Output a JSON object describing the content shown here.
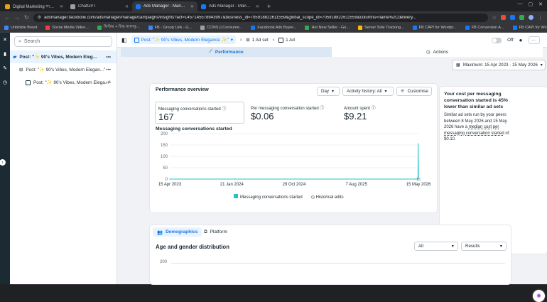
{
  "browser": {
    "tabs": [
      {
        "title": "Digital Marketing সার্ভিসেস স্প্রে",
        "color": "#e4a11b",
        "active": false
      },
      {
        "title": "ChatGPT",
        "color": "#9aa0a6",
        "active": false
      },
      {
        "title": "Ads Manager - Manage ads - C",
        "color": "#1877f2",
        "active": true
      },
      {
        "title": "Ads Manager - Manage ads - A",
        "color": "#1877f2",
        "active": false
      }
    ],
    "new_tab": "+",
    "url": "adsmanager.facebook.com/adsmanager/manage/campaigns/insights?act=1457145578943997&business_id=705918822611559&global_scope_id=705918822611559&columns=name%2Cdelivery...",
    "bookmarks": [
      {
        "label": "Unblokte Boost",
        "color": "#4285f4"
      },
      {
        "label": "Social Media Video...",
        "color": "#ea4335"
      },
      {
        "label": "ফিল্টার + রিস্ক ক্যালকু...",
        "color": "#34a853"
      },
      {
        "label": "FB - Group Link - G...",
        "color": "#4285f4"
      },
      {
        "label": "CCMS || Consume...",
        "color": "#9aa0a6"
      },
      {
        "label": "Facebook Ads Buyer...",
        "color": "#1877f2"
      },
      {
        "label": "Hot New Seller - Go...",
        "color": "#34a853"
      },
      {
        "label": "Server Side Tracking...",
        "color": "#fbbc05"
      },
      {
        "label": "FB CAPI for Wordpr...",
        "color": "#1877f2"
      },
      {
        "label": "FB Conversion A...",
        "color": "#1877f2"
      },
      {
        "label": "FB CAPI for Wordpr...",
        "color": "#1877f2"
      }
    ]
  },
  "left_tree": {
    "search_placeholder": "Search",
    "items": [
      {
        "label": "Post: \"✨ 90's Vibes, Modern Elegance...\"",
        "level": 0,
        "selected": true
      },
      {
        "label": "Post: \"✨ 90's Vibes, Modern Elegan...\"",
        "level": 1,
        "selected": false
      },
      {
        "label": "Post: \"✨ 90's Vibes, Modern Elega...\"",
        "level": 2,
        "selected": false
      }
    ]
  },
  "topbar": {
    "campaign": "Post: \"✨ 90's Vibes, Modern Elegance ✨\"",
    "adset": "1 Ad set",
    "ad": "1 Ad",
    "toggle_label": "Off",
    "more": "···"
  },
  "tabs": {
    "performance": "Performance",
    "actions": "Actions"
  },
  "date_range": "Maximum: 15 Apr 2023 - 15 May 2026",
  "overview": {
    "title": "Performance overview",
    "granularity": "Day",
    "history": "Activity history: All",
    "customise": "Customise",
    "metrics": [
      {
        "label": "Messaging conversations started",
        "value": "167"
      },
      {
        "label": "Per messaging conversation started",
        "value": "$0.06"
      },
      {
        "label": "Amount spent",
        "value": "$9.21"
      }
    ],
    "chart_label": "Messaging conversations started",
    "legend_series": "Messaging conversations started",
    "legend_history": "Historical edits"
  },
  "chart_data": {
    "type": "line",
    "title": "Messaging conversations started",
    "x_ticks": [
      "15 Apr 2023",
      "21 Jan 2024",
      "29 Oct 2024",
      "7 Aug 2025",
      "15 May 2026"
    ],
    "y_ticks": [
      0,
      50,
      100,
      150,
      200
    ],
    "ylim": [
      0,
      200
    ],
    "series": [
      {
        "name": "Messaging conversations started",
        "color": "#22c4c6",
        "x": [
          "15 Apr 2023",
          "1 May 2026",
          "8 May 2026",
          "12 May 2026",
          "13 May 2026",
          "14 May 2026",
          "15 May 2026"
        ],
        "values": [
          0,
          0,
          0,
          0,
          0,
          155,
          6
        ]
      }
    ],
    "annotation": "15"
  },
  "insight": {
    "headline": "Your cost per messaging conversation started is 45% lower than similar ad sets",
    "body_prefix": "Similar ad sets run by your peers between 8 May 2026 and 15 May 2026 have a ",
    "body_link": "median cost per messaging conversation started",
    "body_suffix": " of $0.10."
  },
  "demographics": {
    "tab_demographics": "Demographics",
    "tab_platform": "Platform",
    "title": "Age and gender distribution",
    "filter": "All",
    "metric": "Results",
    "y_top": "200"
  }
}
